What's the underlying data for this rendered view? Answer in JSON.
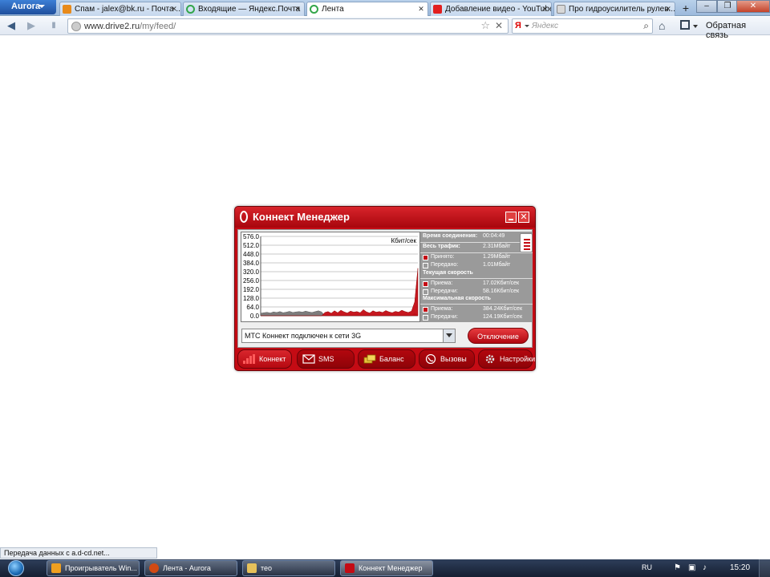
{
  "browser": {
    "app_menu": "Aurora",
    "tabs": [
      {
        "label": "Спам - jalex@bk.ru - Почта ...",
        "icon": "mail-ru-icon",
        "active": false
      },
      {
        "label": "Входящие — Яндекс.Почта",
        "icon": "loading-spinner-icon",
        "active": false
      },
      {
        "label": "Лента",
        "icon": "loading-spinner-icon",
        "active": true
      },
      {
        "label": "Добавление видео - YouTube",
        "icon": "youtube-icon",
        "active": false
      },
      {
        "label": "Про гидроусилитель рулев...",
        "icon": "page-icon",
        "active": false
      }
    ],
    "new_tab": "+",
    "url_host": "www.drive2.ru",
    "url_path": "/my/feed/",
    "search_placeholder": "Яндекс",
    "feedback_label": "Обратная связь",
    "status_text": "Передача данных с a.d-cd.net..."
  },
  "connect_manager": {
    "title": "Коннект Менеджер",
    "chart_unit": "Кбит/сек",
    "stats": {
      "conn_time_label": "Время соединения:",
      "conn_time_value": "00:04:49",
      "total_label": "Весь трафик:",
      "total_value": "2.31Мбайт",
      "received_label": "Принято:",
      "received_value": "1.29Мбайт",
      "sent_label": "Передано:",
      "sent_value": "1.01Мбайт",
      "current_speed_label": "Текущая скорость",
      "cur_rx_label": "Приема:",
      "cur_rx_value": "17.02Кбит/сек",
      "cur_tx_label": "Передачи:",
      "cur_tx_value": "58.16Кбит/сек",
      "max_speed_label": "Максимальная скорость",
      "max_rx_label": "Приема:",
      "max_rx_value": "384.24Кбит/сек",
      "max_tx_label": "Передачи:",
      "max_tx_value": "124.19Кбит/сек"
    },
    "connection_status": "МТС Коннект подключен к сети 3G",
    "disconnect_label": "Отключение",
    "nav_tabs": [
      {
        "label": "Коннект",
        "icon": "signal-bars-icon",
        "active": true
      },
      {
        "label": "SMS",
        "icon": "envelope-icon",
        "active": false
      },
      {
        "label": "Баланс",
        "icon": "coins-icon",
        "active": false
      },
      {
        "label": "Вызовы",
        "icon": "phone-icon",
        "active": false
      },
      {
        "label": "Настройки",
        "icon": "gear-icon",
        "active": false
      }
    ],
    "colors": {
      "brand_red": "#c40b14",
      "send_gray": "#777777"
    }
  },
  "chart_data": {
    "type": "area",
    "ylabel": "Кбит/сек",
    "yticks": [
      "576.0",
      "512.0",
      "448.0",
      "384.0",
      "320.0",
      "256.0",
      "192.0",
      "128.0",
      "64.0",
      "0.0"
    ],
    "ylim": [
      0,
      576
    ],
    "x": [
      0,
      1,
      2,
      3,
      4,
      5,
      6,
      7,
      8,
      9,
      10,
      11,
      12,
      13,
      14,
      15,
      16,
      17,
      18,
      19,
      20,
      21,
      22,
      23,
      24,
      25,
      26,
      27,
      28,
      29,
      30,
      31,
      32,
      33,
      34,
      35,
      36,
      37,
      38,
      39,
      40,
      41,
      42,
      43,
      44,
      45,
      46,
      47,
      48,
      49
    ],
    "series": [
      {
        "values": [
          18,
          22,
          25,
          20,
          28,
          24,
          30,
          22,
          26,
          32,
          24,
          28,
          30,
          26,
          34,
          28,
          24,
          30,
          36,
          28,
          0,
          0,
          0,
          0,
          0,
          0,
          0,
          0,
          0,
          0,
          0,
          0,
          0,
          0,
          0,
          0,
          0,
          0,
          0,
          0,
          0,
          0,
          0,
          0,
          0,
          0,
          0,
          0,
          20,
          0
        ]
      },
      {
        "values": [
          0,
          0,
          0,
          0,
          0,
          0,
          0,
          0,
          0,
          0,
          0,
          0,
          0,
          0,
          0,
          0,
          0,
          0,
          0,
          0,
          24,
          30,
          18,
          36,
          22,
          40,
          28,
          20,
          34,
          26,
          30,
          22,
          44,
          28,
          20,
          36,
          26,
          30,
          24,
          38,
          28,
          22,
          32,
          26,
          40,
          30,
          24,
          34,
          100,
          345
        ]
      }
    ]
  }
}
